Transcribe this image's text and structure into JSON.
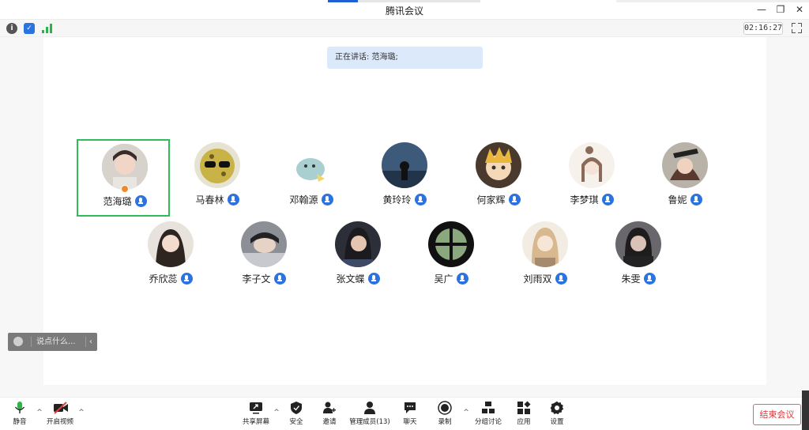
{
  "window": {
    "title": "腾讯会议"
  },
  "status": {
    "timer": "02:16:27"
  },
  "speaking": {
    "text": "正在讲话: 范海璐;"
  },
  "participants": [
    {
      "name": "范海璐",
      "active": true,
      "host": true,
      "avatar_color": "#b9a89b"
    },
    {
      "name": "马春林",
      "avatar_color": "#c8b64a"
    },
    {
      "name": "邓翰源",
      "avatar_color": "#b7d6d6"
    },
    {
      "name": "黄玲玲",
      "avatar_color": "#34506e"
    },
    {
      "name": "何家辉",
      "avatar_color": "#e2b94b"
    },
    {
      "name": "李梦琪",
      "avatar_color": "#e9d8cf"
    },
    {
      "name": "鲁妮",
      "avatar_color": "#8b5a4a"
    },
    {
      "name": "乔欣蕊",
      "avatar_color": "#d8c2b4"
    },
    {
      "name": "李子文",
      "avatar_color": "#7a7d86"
    },
    {
      "name": "张文蝶",
      "avatar_color": "#2c2f38"
    },
    {
      "name": "吴广",
      "avatar_color": "#4a6b46"
    },
    {
      "name": "刘雨双",
      "avatar_color": "#d9c1a3"
    },
    {
      "name": "朱雯",
      "avatar_color": "#5c5a5e"
    }
  ],
  "chat": {
    "placeholder": "说点什么..."
  },
  "toolbar": {
    "mute": "静音",
    "video": "开启视频",
    "share": "共享屏幕",
    "security": "安全",
    "invite": "邀请",
    "members": "管理成员(13)",
    "chat": "聊天",
    "record": "录制",
    "breakout": "分组讨论",
    "apps": "应用",
    "settings": "设置",
    "end": "结束会议"
  }
}
